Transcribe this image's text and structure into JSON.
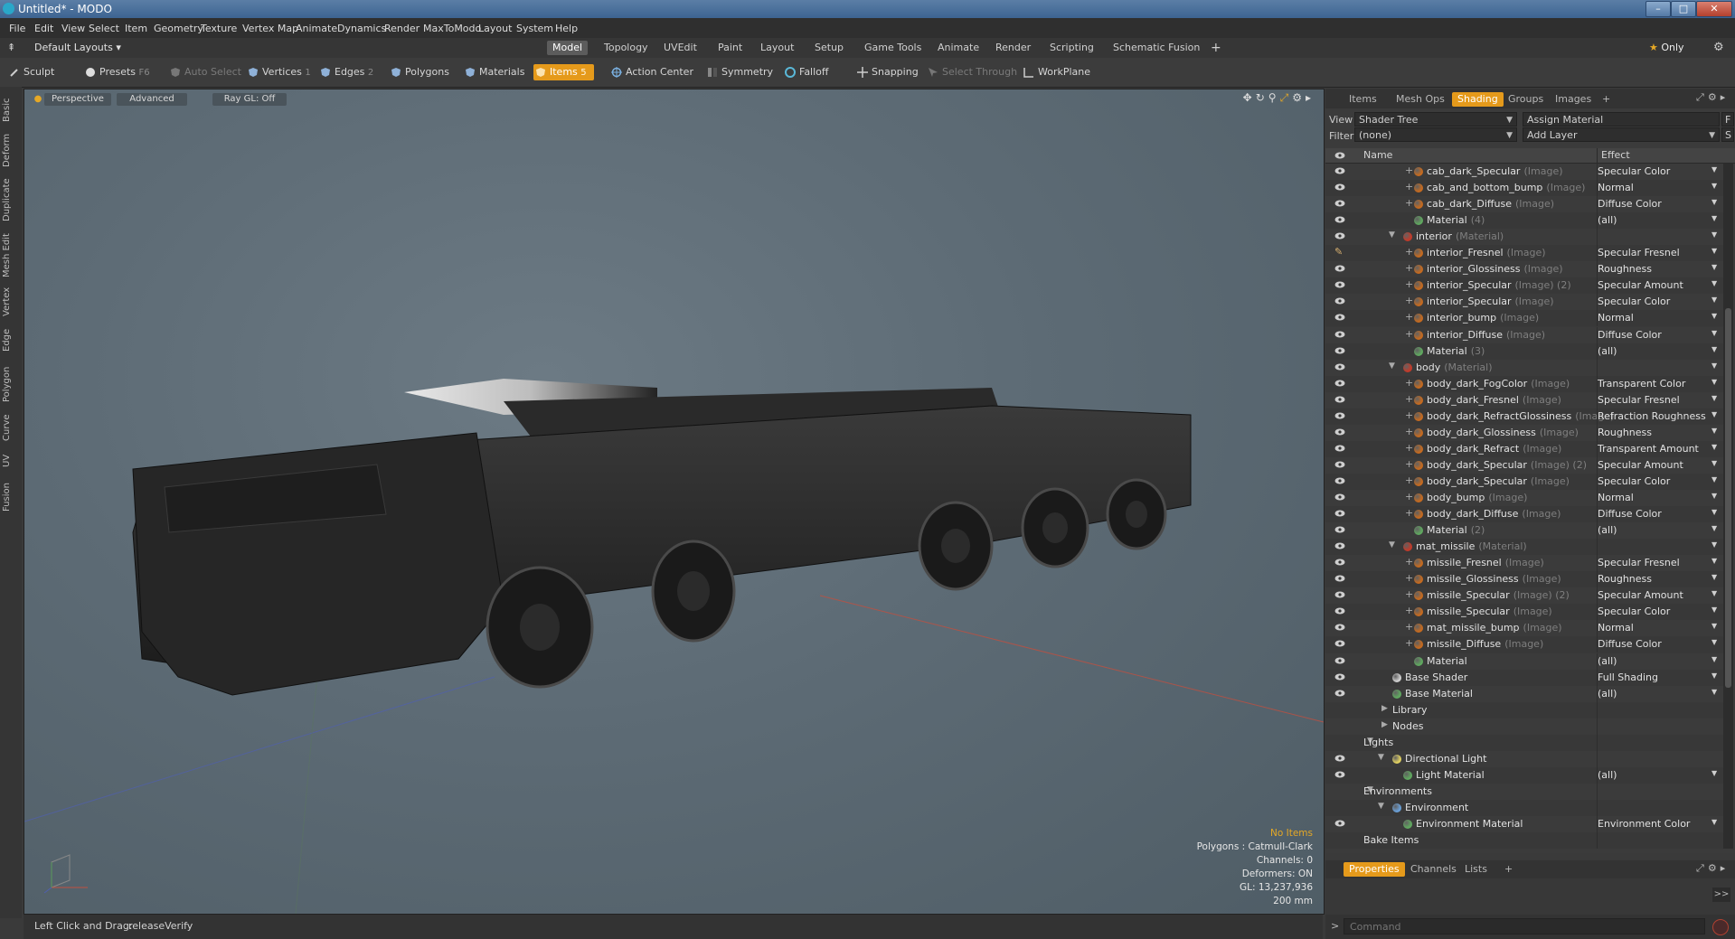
{
  "window": {
    "title": "Untitled* - MODO",
    "min": "–",
    "max": "□",
    "close": "✕"
  },
  "menu": [
    "File",
    "Edit",
    "View",
    "Select",
    "Item",
    "Geometry",
    "Texture",
    "Vertex Map",
    "Animate",
    "Dynamics",
    "Render",
    "MaxToModo",
    "Layout",
    "System",
    "Help"
  ],
  "layoutbar": {
    "layouts_label": "Default Layouts",
    "tabs": [
      "Model",
      "Topology",
      "UVEdit",
      "Paint",
      "Layout",
      "Setup",
      "Game Tools",
      "Animate",
      "Render",
      "Scripting",
      "Schematic Fusion"
    ],
    "active_tab": "Model",
    "add": "+",
    "only_label": "Only"
  },
  "toolbar": {
    "sculpt": "Sculpt",
    "presets": "Presets",
    "presets_key": "F6",
    "auto_select": "Auto Select",
    "vertices": "Vertices",
    "vertices_key": "1",
    "edges": "Edges",
    "edges_key": "2",
    "polygons": "Polygons",
    "materials": "Materials",
    "items": "Items",
    "items_key": "5",
    "action_center": "Action Center",
    "symmetry": "Symmetry",
    "falloff": "Falloff",
    "snapping": "Snapping",
    "select_through": "Select Through",
    "workplane": "WorkPlane"
  },
  "left_tabs": [
    "Basic",
    "Deform",
    "Duplicate",
    "Mesh Edit",
    "Vertex",
    "Edge",
    "Polygon",
    "Curve",
    "UV",
    "Fusion"
  ],
  "viewport": {
    "perspective": "Perspective",
    "advanced": "Advanced",
    "raygl": "Ray GL: Off",
    "info": {
      "no_items": "No Items",
      "polygons": "Polygons : Catmull-Clark",
      "channels": "Channels: 0",
      "deformers": "Deformers: ON",
      "gl": "GL: 13,237,936",
      "scale": "200 mm"
    }
  },
  "status": {
    "label": "Left Click and Drag:",
    "value": "releaseVerify"
  },
  "right_panel": {
    "tabs": [
      "Items",
      "Mesh Ops",
      "Shading",
      "Groups",
      "Images"
    ],
    "active_tab": "Shading",
    "add": "+",
    "view_label": "View",
    "view_value": "Shader Tree",
    "assign_material": "Assign Material",
    "f_btn": "F",
    "filter_label": "Filter",
    "filter_value": "(none)",
    "add_layer": "Add Layer",
    "s_btn": "S",
    "col_name": "Name",
    "col_effect": "Effect"
  },
  "tree": [
    {
      "indent": 3,
      "kind": "image",
      "name": "cab_dark_Specular",
      "type": "(Image)",
      "effect": "Specular Color",
      "eye": true
    },
    {
      "indent": 3,
      "kind": "image",
      "name": "cab_and_bottom_bump",
      "type": "(Image)",
      "effect": "Normal",
      "eye": true
    },
    {
      "indent": 3,
      "kind": "image",
      "name": "cab_dark_Diffuse",
      "type": "(Image)",
      "effect": "Diffuse Color",
      "eye": true
    },
    {
      "indent": 3,
      "kind": "material",
      "name": "Material",
      "type": "(4)",
      "effect": "(all)",
      "eye": true
    },
    {
      "indent": 2,
      "kind": "mask",
      "name": "interior",
      "type": "(Material)",
      "effect": "",
      "eye": true,
      "open": true
    },
    {
      "indent": 3,
      "kind": "image",
      "name": "interior_Fresnel",
      "type": "(Image)",
      "effect": "Specular Fresnel",
      "eye": "brush"
    },
    {
      "indent": 3,
      "kind": "image",
      "name": "interior_Glossiness",
      "type": "(Image)",
      "effect": "Roughness",
      "eye": true
    },
    {
      "indent": 3,
      "kind": "image",
      "name": "interior_Specular",
      "type": "(Image) (2)",
      "effect": "Specular Amount",
      "eye": true
    },
    {
      "indent": 3,
      "kind": "image",
      "name": "interior_Specular",
      "type": "(Image)",
      "effect": "Specular Color",
      "eye": true
    },
    {
      "indent": 3,
      "kind": "image",
      "name": "interior_bump",
      "type": "(Image)",
      "effect": "Normal",
      "eye": true
    },
    {
      "indent": 3,
      "kind": "image",
      "name": "interior_Diffuse",
      "type": "(Image)",
      "effect": "Diffuse Color",
      "eye": true
    },
    {
      "indent": 3,
      "kind": "material",
      "name": "Material",
      "type": "(3)",
      "effect": "(all)",
      "eye": true
    },
    {
      "indent": 2,
      "kind": "mask",
      "name": "body",
      "type": "(Material)",
      "effect": "",
      "eye": true,
      "open": true
    },
    {
      "indent": 3,
      "kind": "image",
      "name": "body_dark_FogColor",
      "type": "(Image)",
      "effect": "Transparent Color",
      "eye": true
    },
    {
      "indent": 3,
      "kind": "image",
      "name": "body_dark_Fresnel",
      "type": "(Image)",
      "effect": "Specular Fresnel",
      "eye": true
    },
    {
      "indent": 3,
      "kind": "image",
      "name": "body_dark_RefractGlossiness",
      "type": "(Image)",
      "effect": "Refraction Roughness",
      "eye": true
    },
    {
      "indent": 3,
      "kind": "image",
      "name": "body_dark_Glossiness",
      "type": "(Image)",
      "effect": "Roughness",
      "eye": true
    },
    {
      "indent": 3,
      "kind": "image",
      "name": "body_dark_Refract",
      "type": "(Image)",
      "effect": "Transparent Amount",
      "eye": true
    },
    {
      "indent": 3,
      "kind": "image",
      "name": "body_dark_Specular",
      "type": "(Image) (2)",
      "effect": "Specular Amount",
      "eye": true
    },
    {
      "indent": 3,
      "kind": "image",
      "name": "body_dark_Specular",
      "type": "(Image)",
      "effect": "Specular Color",
      "eye": true
    },
    {
      "indent": 3,
      "kind": "image",
      "name": "body_bump",
      "type": "(Image)",
      "effect": "Normal",
      "eye": true
    },
    {
      "indent": 3,
      "kind": "image",
      "name": "body_dark_Diffuse",
      "type": "(Image)",
      "effect": "Diffuse Color",
      "eye": true
    },
    {
      "indent": 3,
      "kind": "material",
      "name": "Material",
      "type": "(2)",
      "effect": "(all)",
      "eye": true
    },
    {
      "indent": 2,
      "kind": "mask",
      "name": "mat_missile",
      "type": "(Material)",
      "effect": "",
      "eye": true,
      "open": true
    },
    {
      "indent": 3,
      "kind": "image",
      "name": "missile_Fresnel",
      "type": "(Image)",
      "effect": "Specular Fresnel",
      "eye": true
    },
    {
      "indent": 3,
      "kind": "image",
      "name": "missile_Glossiness",
      "type": "(Image)",
      "effect": "Roughness",
      "eye": true
    },
    {
      "indent": 3,
      "kind": "image",
      "name": "missile_Specular",
      "type": "(Image) (2)",
      "effect": "Specular Amount",
      "eye": true
    },
    {
      "indent": 3,
      "kind": "image",
      "name": "missile_Specular",
      "type": "(Image)",
      "effect": "Specular Color",
      "eye": true
    },
    {
      "indent": 3,
      "kind": "image",
      "name": "mat_missile_bump",
      "type": "(Image)",
      "effect": "Normal",
      "eye": true
    },
    {
      "indent": 3,
      "kind": "image",
      "name": "missile_Diffuse",
      "type": "(Image)",
      "effect": "Diffuse Color",
      "eye": true
    },
    {
      "indent": 3,
      "kind": "material",
      "name": "Material",
      "type": "",
      "effect": "(all)",
      "eye": true
    },
    {
      "indent": 1,
      "kind": "shader",
      "name": "Base Shader",
      "type": "",
      "effect": "Full Shading",
      "eye": true
    },
    {
      "indent": 1,
      "kind": "material",
      "name": "Base Material",
      "type": "",
      "effect": "(all)",
      "eye": true
    },
    {
      "indent": 1,
      "kind": "folder",
      "name": "Library",
      "type": "",
      "effect": "",
      "eye": false
    },
    {
      "indent": 1,
      "kind": "folder",
      "name": "Nodes",
      "type": "",
      "effect": "",
      "eye": false
    },
    {
      "indent": 0,
      "kind": "group",
      "name": "Lights",
      "type": "",
      "effect": "",
      "eye": false,
      "open": true
    },
    {
      "indent": 1,
      "kind": "light",
      "name": "Directional Light",
      "type": "",
      "effect": "",
      "eye": true,
      "open": true
    },
    {
      "indent": 2,
      "kind": "material",
      "name": "Light Material",
      "type": "",
      "effect": "(all)",
      "eye": true
    },
    {
      "indent": 0,
      "kind": "group",
      "name": "Environments",
      "type": "",
      "effect": "",
      "eye": false,
      "open": true
    },
    {
      "indent": 1,
      "kind": "env",
      "name": "Environment",
      "type": "",
      "effect": "",
      "eye": false,
      "open": true
    },
    {
      "indent": 2,
      "kind": "material",
      "name": "Environment Material",
      "type": "",
      "effect": "Environment Color",
      "eye": true
    },
    {
      "indent": 0,
      "kind": "plain",
      "name": "Bake Items",
      "type": "",
      "effect": "",
      "eye": false
    }
  ],
  "bottom_panel": {
    "tabs": [
      "Properties",
      "Channels",
      "Lists"
    ],
    "active_tab": "Properties",
    "add": "+",
    "expand": ">>"
  },
  "command": {
    "prompt": ">",
    "placeholder": "Command"
  },
  "colors": {
    "accent": "#e59a1b",
    "ground_x_axis": "#c05040",
    "ground_z_axis": "#5060b0"
  }
}
